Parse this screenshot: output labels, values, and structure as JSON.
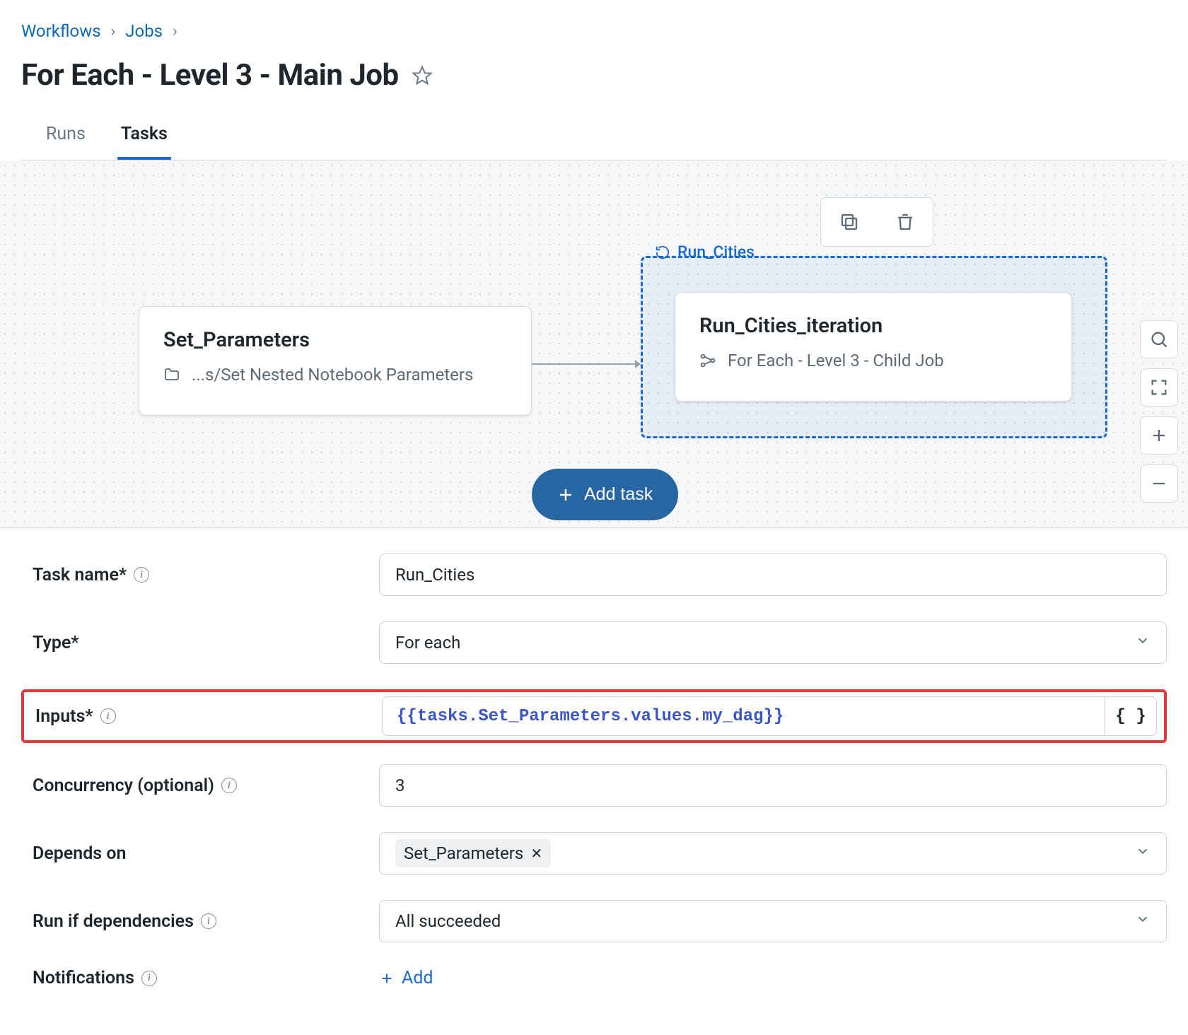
{
  "breadcrumb": {
    "workflows": "Workflows",
    "jobs": "Jobs"
  },
  "page_title": "For Each - Level 3 - Main Job",
  "tabs": {
    "runs": "Runs",
    "tasks": "Tasks"
  },
  "canvas": {
    "group_label": "Run_Cities",
    "node_set": {
      "title": "Set_Parameters",
      "subtitle": "...s/Set Nested Notebook Parameters"
    },
    "node_iter": {
      "title": "Run_Cities_iteration",
      "subtitle": "For Each - Level 3 - Child Job"
    },
    "add_task_label": "Add task"
  },
  "form": {
    "task_name_label": "Task name*",
    "task_name_value": "Run_Cities",
    "type_label": "Type*",
    "type_value": "For each",
    "inputs_label": "Inputs*",
    "inputs_value_path": "tasks.Set_Parameters.values.my_dag",
    "concurrency_label": "Concurrency (optional)",
    "concurrency_value": "3",
    "depends_label": "Depends on",
    "depends_chip": "Set_Parameters",
    "runif_label": "Run if dependencies",
    "runif_value": "All succeeded",
    "notifications_label": "Notifications",
    "notifications_add": "Add",
    "brace_button": "{ }"
  }
}
